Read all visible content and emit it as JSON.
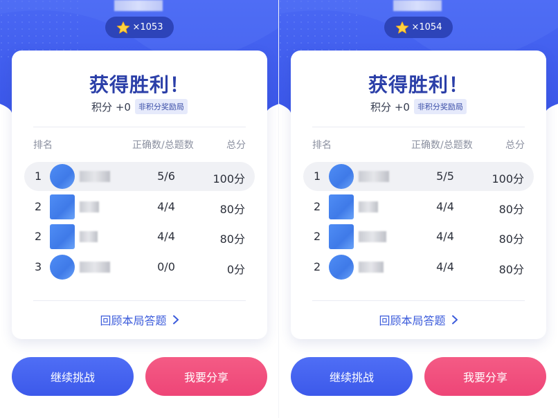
{
  "panels": [
    {
      "coin_text": "×1053",
      "result_title": "获得胜利！",
      "score_text": "积分 +0",
      "bonus_tag": "非积分奖励局",
      "headers": {
        "rank": "排名",
        "correct": "正确数/总题数",
        "total": "总分"
      },
      "rows": [
        {
          "rank": "1",
          "correct": "5/6",
          "total": "100分",
          "highlight": true
        },
        {
          "rank": "2",
          "correct": "4/4",
          "total": "80分",
          "highlight": false
        },
        {
          "rank": "2",
          "correct": "4/4",
          "total": "80分",
          "highlight": false
        },
        {
          "rank": "3",
          "correct": "0/0",
          "total": "0分",
          "highlight": false
        }
      ],
      "review_label": "回顾本局答题",
      "continue_label": "继续挑战",
      "share_label": "我要分享"
    },
    {
      "coin_text": "×1054",
      "result_title": "获得胜利！",
      "score_text": "积分 +0",
      "bonus_tag": "非积分奖励局",
      "headers": {
        "rank": "排名",
        "correct": "正确数/总题数",
        "total": "总分"
      },
      "rows": [
        {
          "rank": "1",
          "correct": "5/5",
          "total": "100分",
          "highlight": true
        },
        {
          "rank": "2",
          "correct": "4/4",
          "total": "80分",
          "highlight": false
        },
        {
          "rank": "2",
          "correct": "4/4",
          "total": "80分",
          "highlight": false
        },
        {
          "rank": "2",
          "correct": "4/4",
          "total": "80分",
          "highlight": false
        }
      ],
      "review_label": "回顾本局答题",
      "continue_label": "继续挑战",
      "share_label": "我要分享"
    }
  ],
  "colors": {
    "hero_blue": "#3f5ff0",
    "title_blue": "#2b3fa8",
    "continue_blue": "#4a66f2",
    "share_pink": "#f2507e",
    "link_blue": "#3b5bdb"
  },
  "icons": {
    "star": "star-icon",
    "chevron": "chevron-right-icon"
  }
}
